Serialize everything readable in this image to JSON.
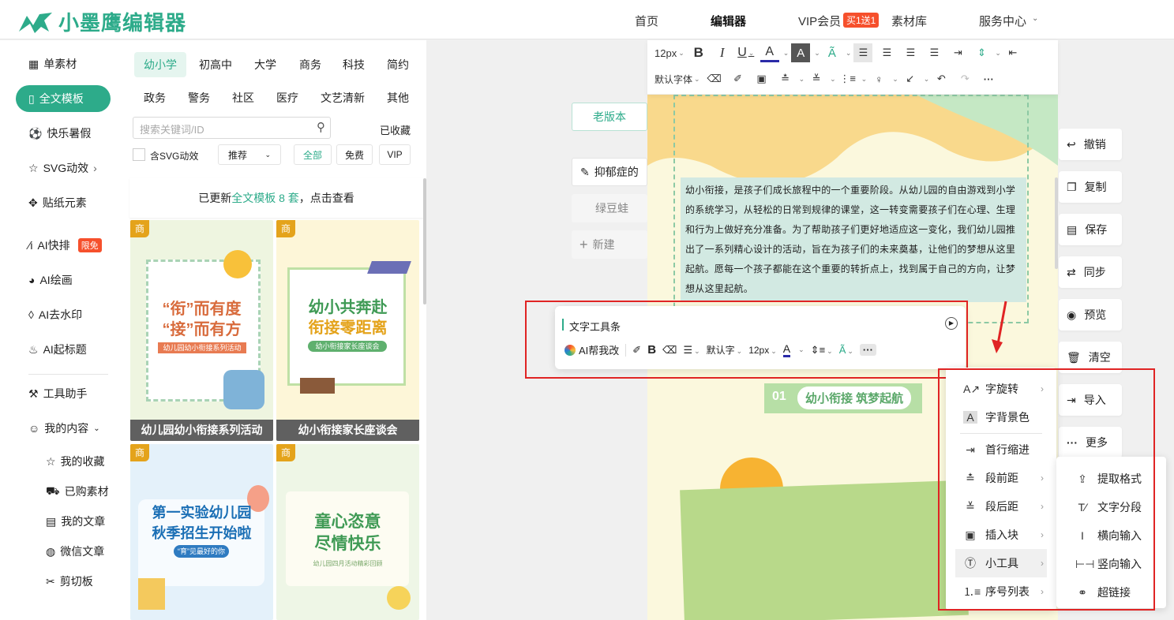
{
  "header": {
    "logo_text": "小墨鹰编辑器",
    "nav": [
      "首页",
      "编辑器",
      "VIP会员",
      "素材库",
      "服务中心"
    ],
    "vip_badge": "买1送1"
  },
  "sidebar": {
    "items": [
      "单素材",
      "全文模板",
      "快乐暑假",
      "SVG动效",
      "贴纸元素",
      "AI快排",
      "AI绘画",
      "AI去水印",
      "AI起标题",
      "工具助手",
      "我的内容"
    ],
    "free_badge": "限免",
    "sub_items": [
      "我的收藏",
      "已购素材",
      "我的文章",
      "微信文章",
      "剪切板"
    ]
  },
  "templates": {
    "categories_row1": [
      "幼小学",
      "初高中",
      "大学",
      "商务",
      "科技",
      "简约"
    ],
    "categories_row2": [
      "政务",
      "警务",
      "社区",
      "医疗",
      "文艺清新",
      "其他"
    ],
    "search_placeholder": "搜索关键词/ID",
    "collected": "已收藏",
    "svg_check": "含SVG动效",
    "sort": "推荐",
    "filters": [
      "全部",
      "免费",
      "VIP"
    ],
    "notice_prefix": "已更新",
    "notice_highlight": "全文模板 8 套",
    "notice_suffix": "，点击查看",
    "tag": "商",
    "cards": [
      {
        "title1": "“衔”而有度",
        "title2": "“接”而有方",
        "subtitle": "幼儿园幼小衔接系列活动",
        "label": "幼儿园幼小衔接系列活动"
      },
      {
        "title1": "幼小共奔赴",
        "title2": "衔接零距离",
        "subtitle": "幼小衔接家长座谈会",
        "label": "幼小衔接家长座谈会"
      },
      {
        "title1": "第一实验幼儿园",
        "title2": "秋季招生开始啦",
        "subtitle": "“育”见最好的你",
        "label": ""
      },
      {
        "title1": "童心恣意",
        "title2": "尽情快乐",
        "subtitle": "幼儿园四月活动精彩回顾",
        "label": ""
      }
    ]
  },
  "middle": {
    "old_version": "老版本",
    "articles": [
      "抑郁症的",
      "绿豆蛙"
    ],
    "new": "新建"
  },
  "toolbar": {
    "font_size": "12px",
    "font_family": "默认字体"
  },
  "canvas": {
    "paragraph": "幼小衔接，是孩子们成长旅程中的一个重要阶段。从幼儿园的自由游戏到小学的系统学习，从轻松的日常到规律的课堂，这一转变需要孩子们在心理、生理和行为上做好充分准备。为了帮助孩子们更好地适应这一变化，我们幼儿园推出了一系列精心设计的活动，旨在为孩子们的未来奠基，让他们的梦想从这里起航。愿每一个孩子都能在这个重要的转折点上，找到属于自己的方向，让梦想从这里起航。",
    "section_no": "01",
    "section_title": "幼小衔接 筑梦起航"
  },
  "text_toolbar": {
    "title": "文字工具条",
    "ai": "AI帮我改",
    "font": "默认字",
    "size": "12px"
  },
  "right_tools": [
    "撤销",
    "复制",
    "保存",
    "同步",
    "预览",
    "清空",
    "导入",
    "更多"
  ],
  "more_menu": [
    "字旋转",
    "字背景色",
    "首行缩进",
    "段前距",
    "段后距",
    "插入块",
    "小工具",
    "序号列表"
  ],
  "tools_submenu": [
    "提取格式",
    "文字分段",
    "横向输入",
    "竖向输入",
    "超链接"
  ],
  "colors": {
    "brand": "#2dab8a",
    "accent_red": "#e02424",
    "badge": "#f6502c"
  }
}
